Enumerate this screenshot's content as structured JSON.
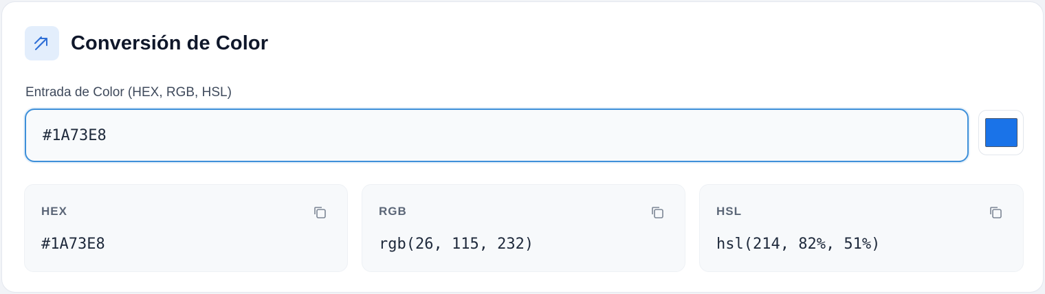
{
  "header": {
    "title": "Conversión de Color",
    "icon": "arrow-up-right-icon",
    "icon_bg": "#e3eefc",
    "icon_color": "#2f6fd6"
  },
  "input": {
    "label": "Entrada de Color (HEX, RGB, HSL)",
    "value": "#1A73E8",
    "focus_color": "#3d8fd9"
  },
  "swatch": {
    "color": "#1A73E8"
  },
  "results": [
    {
      "label": "HEX",
      "value": "#1A73E8",
      "icon": "copy-icon"
    },
    {
      "label": "RGB",
      "value": "rgb(26, 115, 232)",
      "icon": "copy-icon"
    },
    {
      "label": "HSL",
      "value": "hsl(214, 82%, 51%)",
      "icon": "copy-icon"
    }
  ]
}
